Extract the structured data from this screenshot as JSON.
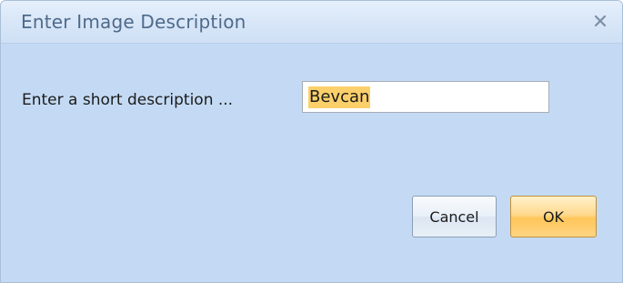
{
  "dialog": {
    "title": "Enter Image Description",
    "close_glyph": "x",
    "prompt_label": "Enter a short description ...",
    "description_value": "Bevcan",
    "cancel_label": "Cancel",
    "ok_label": "OK"
  },
  "icons": {
    "close": "close-icon"
  },
  "colors": {
    "title_text": "#4e6a8a",
    "dialog_background": "#c4daf4",
    "selection_highlight": "#fbd06b",
    "ok_button": "#ffc65a"
  }
}
